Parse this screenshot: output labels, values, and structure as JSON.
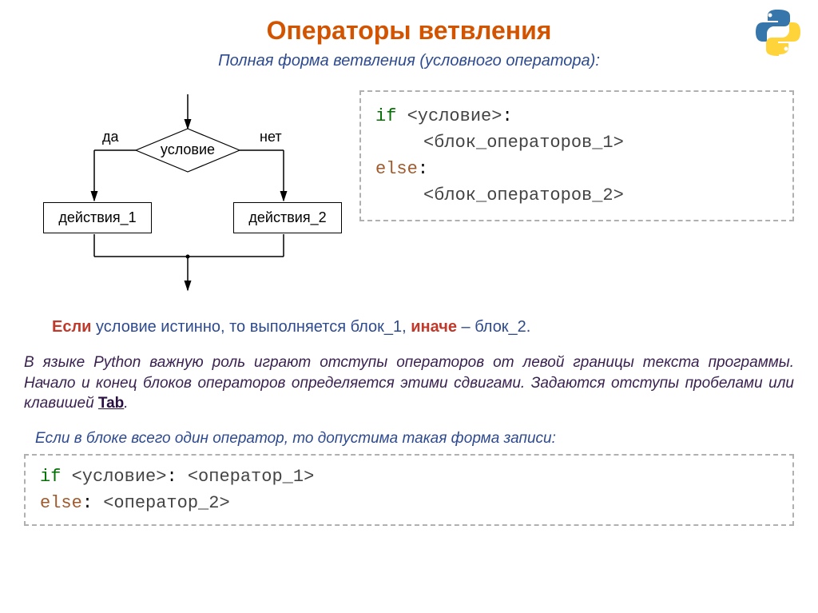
{
  "title": "Операторы ветвления",
  "subtitle": "Полная форма ветвления (условного оператора):",
  "flowchart": {
    "yes": "да",
    "no": "нет",
    "condition": "условие",
    "action1": "действия_1",
    "action2": "действия_2"
  },
  "code1": {
    "if_kw": "if",
    "cond": "<условие>",
    "colon": ":",
    "block1": "<блок_операторов_1>",
    "else_kw": "else",
    "block2": "<блок_операторов_2>"
  },
  "explain1": {
    "kw1": "Если",
    "mid": " условие истинно, то выполняется блок_1, ",
    "kw2": "иначе",
    "end": " – блок_2."
  },
  "explain2": {
    "text": "В языке Python важную роль играют отступы операторов от левой границы текста программы. Начало и конец блоков операторов определяется этими сдвигами. Задаются отступы пробелами или клавишей ",
    "tab": "Tab",
    "dot": "."
  },
  "explain3": "Если в блоке всего один оператор, то допустима такая форма записи:",
  "code2": {
    "if_kw": "if",
    "cond": "<условие>",
    "colon": ":",
    "op1": "<оператор_1>",
    "else_kw": "else",
    "op2": "<оператор_2>"
  }
}
